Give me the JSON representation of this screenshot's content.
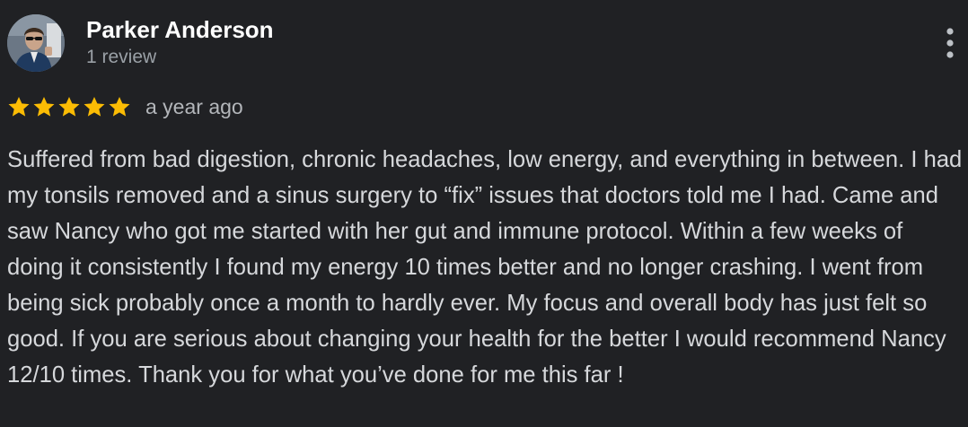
{
  "review": {
    "author_name": "Parker Anderson",
    "review_count": "1 review",
    "rating": 5,
    "rating_max": 5,
    "date": "a year ago",
    "text": "Suffered from bad digestion, chronic headaches, low energy, and everything in between. I had my tonsils removed and a sinus surgery to “fix” issues that doctors told me I had. Came and saw Nancy who got me started with her gut and immune protocol. Within a few weeks of doing it consistently I found my energy 10 times better and no longer crashing. I went from being sick probably once a month to hardly ever. My focus and overall body has just felt so good. If you are serious about changing your health for the better I would recommend Nancy 12/10 times. Thank you for what you’ve done for me this far !"
  },
  "icons": {
    "menu": "more-vertical-icon",
    "star": "star-icon",
    "avatar": "avatar-photo"
  },
  "colors": {
    "background": "#202124",
    "star": "#fbbc04",
    "name": "#ffffff",
    "secondary": "#9aa0a6",
    "body_text": "#d6d8db"
  }
}
